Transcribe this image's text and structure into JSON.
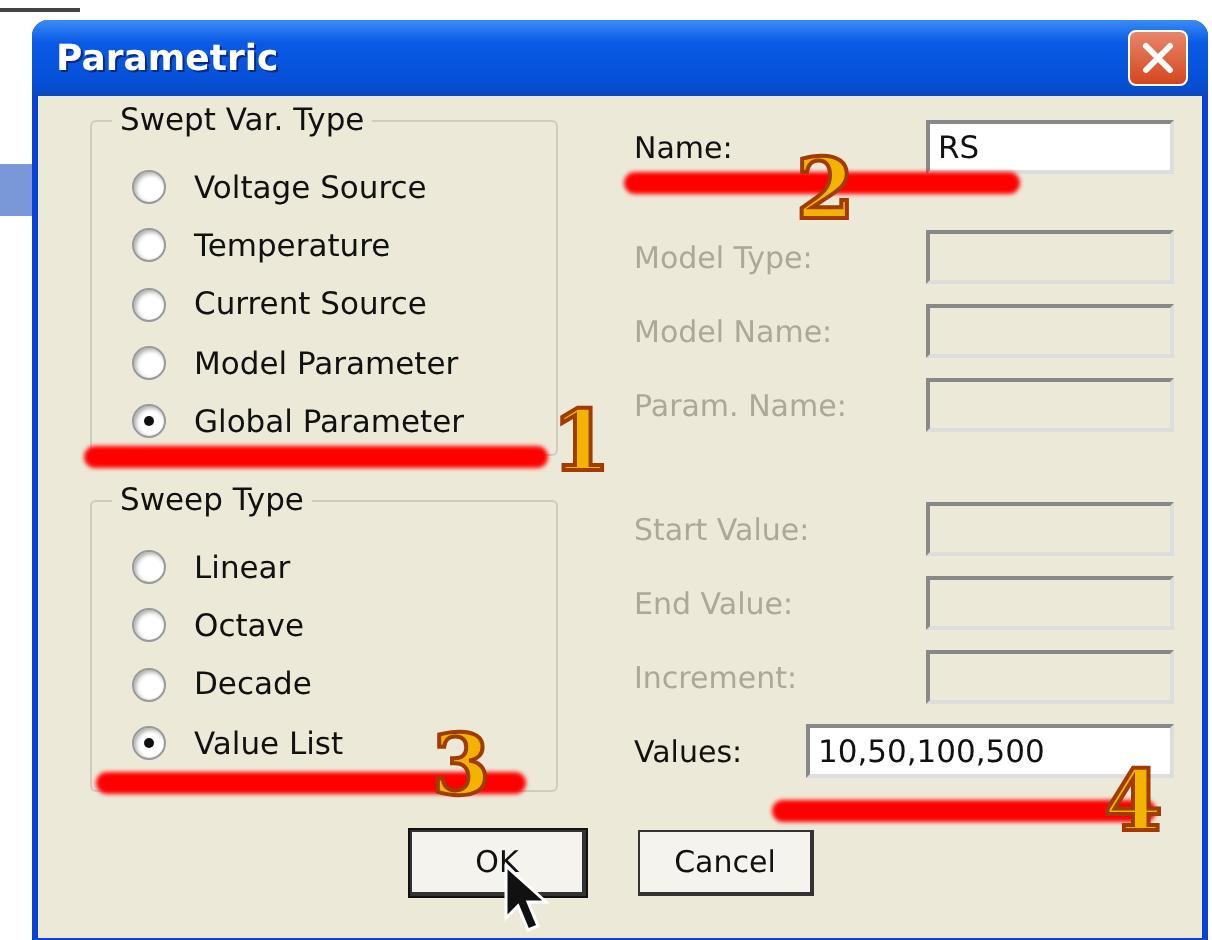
{
  "window": {
    "title": "Parametric"
  },
  "swept_var_type": {
    "title": "Swept Var. Type",
    "options": [
      {
        "label": "Voltage Source",
        "selected": false
      },
      {
        "label": "Temperature",
        "selected": false
      },
      {
        "label": "Current Source",
        "selected": false
      },
      {
        "label": "Model Parameter",
        "selected": false
      },
      {
        "label": "Global Parameter",
        "selected": true
      }
    ]
  },
  "sweep_type": {
    "title": "Sweep Type",
    "options": [
      {
        "label": "Linear",
        "selected": false
      },
      {
        "label": "Octave",
        "selected": false
      },
      {
        "label": "Decade",
        "selected": false
      },
      {
        "label": "Value List",
        "selected": true
      }
    ]
  },
  "name_field": {
    "label": "Name:",
    "value": "RS",
    "disabled": false
  },
  "model_fields": [
    {
      "label": "Model Type:",
      "disabled": true
    },
    {
      "label": "Model Name:",
      "disabled": true
    },
    {
      "label": "Param. Name:",
      "disabled": true
    }
  ],
  "range_fields": [
    {
      "label": "Start Value:",
      "disabled": true
    },
    {
      "label": "End Value:",
      "disabled": true
    },
    {
      "label": "Increment:",
      "disabled": true
    }
  ],
  "values_field": {
    "label": "Values:",
    "value": "10,50,100,500",
    "disabled": false
  },
  "buttons": [
    "OK",
    "Cancel"
  ],
  "annotations": [
    "1",
    "2",
    "3",
    "4"
  ]
}
